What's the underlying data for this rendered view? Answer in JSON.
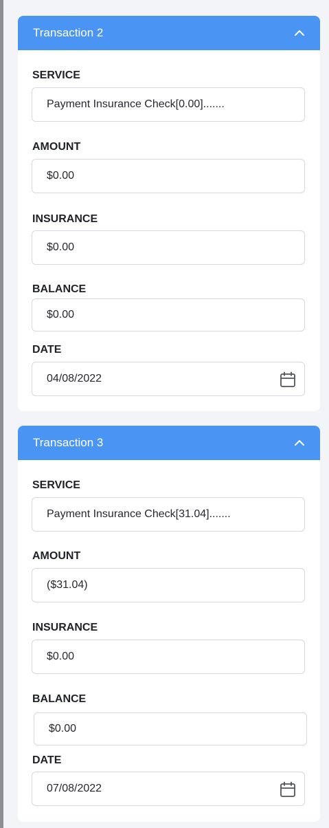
{
  "transactions": [
    {
      "title": "Transaction 2",
      "service_label": "SERVICE",
      "service_value": "Payment Insurance Check[0.00].......",
      "amount_label": "AMOUNT",
      "amount_value": "$0.00",
      "insurance_label": "INSURANCE",
      "insurance_value": "$0.00",
      "balance_label": "BALANCE",
      "balance_value": "$0.00",
      "date_label": "DATE",
      "date_value": "04/08/2022"
    },
    {
      "title": "Transaction 3",
      "service_label": "SERVICE",
      "service_value": "Payment Insurance Check[31.04].......",
      "amount_label": "AMOUNT",
      "amount_value": "($31.04)",
      "insurance_label": "INSURANCE",
      "insurance_value": "$0.00",
      "balance_label": "BALANCE",
      "balance_value": "$0.00",
      "date_label": "DATE",
      "date_value": "07/08/2022"
    }
  ],
  "icons": {
    "collapse": "chevron-up-icon",
    "date": "calendar-icon"
  },
  "colors": {
    "header": "#4a95f3",
    "background": "#f3f4f7",
    "border": "#d5d8de"
  }
}
